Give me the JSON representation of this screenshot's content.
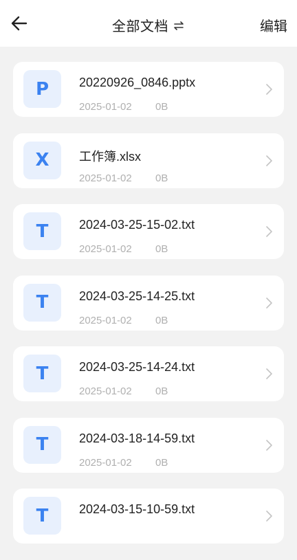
{
  "header": {
    "title": "全部文档",
    "edit_label": "编辑"
  },
  "files": [
    {
      "letter": "P",
      "name": "20220926_0846.pptx",
      "date": "2025-01-02",
      "size": "0B"
    },
    {
      "letter": "X",
      "name": "工作簿.xlsx",
      "date": "2025-01-02",
      "size": "0B"
    },
    {
      "letter": "T",
      "name": "2024-03-25-15-02.txt",
      "date": "2025-01-02",
      "size": "0B"
    },
    {
      "letter": "T",
      "name": "2024-03-25-14-25.txt",
      "date": "2025-01-02",
      "size": "0B"
    },
    {
      "letter": "T",
      "name": "2024-03-25-14-24.txt",
      "date": "2025-01-02",
      "size": "0B"
    },
    {
      "letter": "T",
      "name": "2024-03-18-14-59.txt",
      "date": "2025-01-02",
      "size": "0B"
    },
    {
      "letter": "T",
      "name": "2024-03-15-10-59.txt",
      "date": "",
      "size": ""
    }
  ],
  "colors": {
    "accent": "#3b82f0",
    "icon_bg": "#e8f0fd",
    "page_bg": "#f2f2f2"
  }
}
